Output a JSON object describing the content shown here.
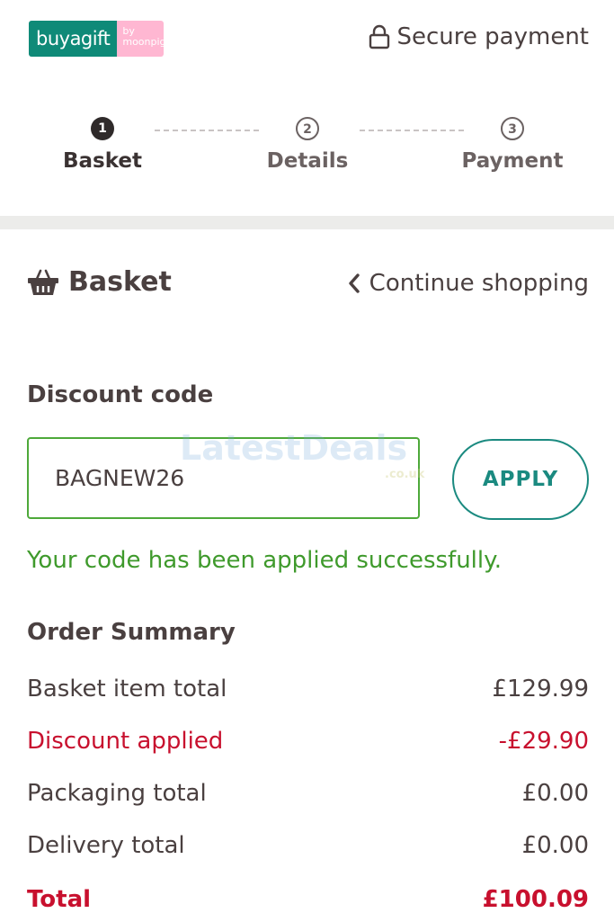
{
  "header": {
    "logo_main": "buyagift",
    "logo_sub": "by moonpig",
    "secure_label": "Secure payment"
  },
  "stepper": {
    "steps": [
      {
        "number": "1",
        "label": "Basket"
      },
      {
        "number": "2",
        "label": "Details"
      },
      {
        "number": "3",
        "label": "Payment"
      }
    ]
  },
  "basket": {
    "title": "Basket",
    "continue_label": "Continue shopping"
  },
  "discount": {
    "label": "Discount code",
    "code_value": "BAGNEW26",
    "apply_label": "APPLY",
    "success_message": "Your code has been applied successfully."
  },
  "order_summary": {
    "title": "Order Summary",
    "rows": [
      {
        "label": "Basket item total",
        "value": "£129.99"
      },
      {
        "label": "Discount applied",
        "value": "-£29.90"
      },
      {
        "label": "Packaging total",
        "value": "£0.00"
      },
      {
        "label": "Delivery total",
        "value": "£0.00"
      },
      {
        "label": "Total",
        "value": "£100.09"
      }
    ]
  },
  "watermark": {
    "text": "LatestDeals",
    "sub": ".co.uk"
  },
  "colors": {
    "brand_teal": "#0f8a78",
    "brand_pink": "#ffb7d2",
    "apply_teal": "#1b8a80",
    "success_green": "#3f9a2c",
    "discount_red": "#c8102e"
  }
}
